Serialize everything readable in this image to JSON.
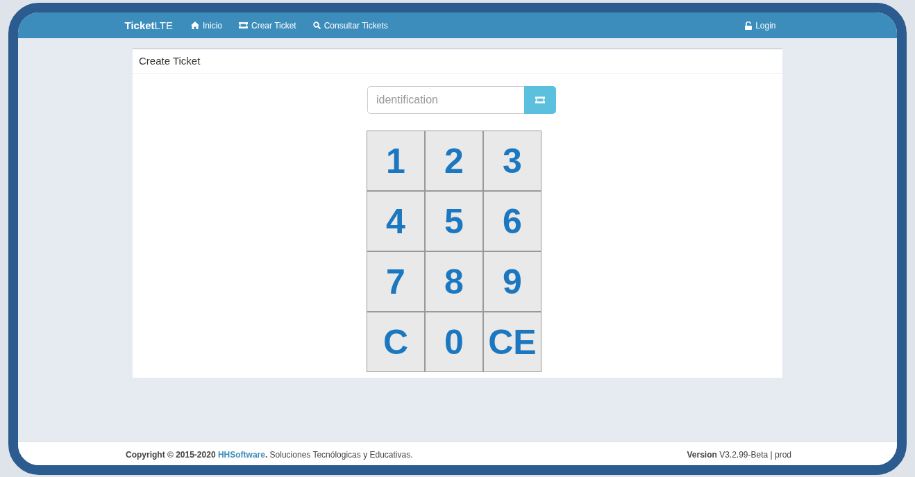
{
  "navbar": {
    "brand": "**Ticket**LTE",
    "items": [
      {
        "label": "Inicio"
      },
      {
        "label": "Crear Ticket"
      },
      {
        "label": "Consultar Tickets"
      }
    ],
    "login": {
      "label": "Login"
    }
  },
  "panel": {
    "title": "Create Ticket",
    "input": {
      "placeholder": "identification"
    },
    "keypad": [
      "1",
      "2",
      "3",
      "4",
      "5",
      "6",
      "7",
      "8",
      "9",
      "C",
      "0",
      "CE"
    ]
  },
  "footer": {
    "copyright": "**Copyright © 2015-2020**",
    "company": "HHSoftware",
    "tail": "**.** Soluciones Tecnólogicas y Educativas.",
    "version": "**Version** V3.2.99-Beta | prod"
  }
}
